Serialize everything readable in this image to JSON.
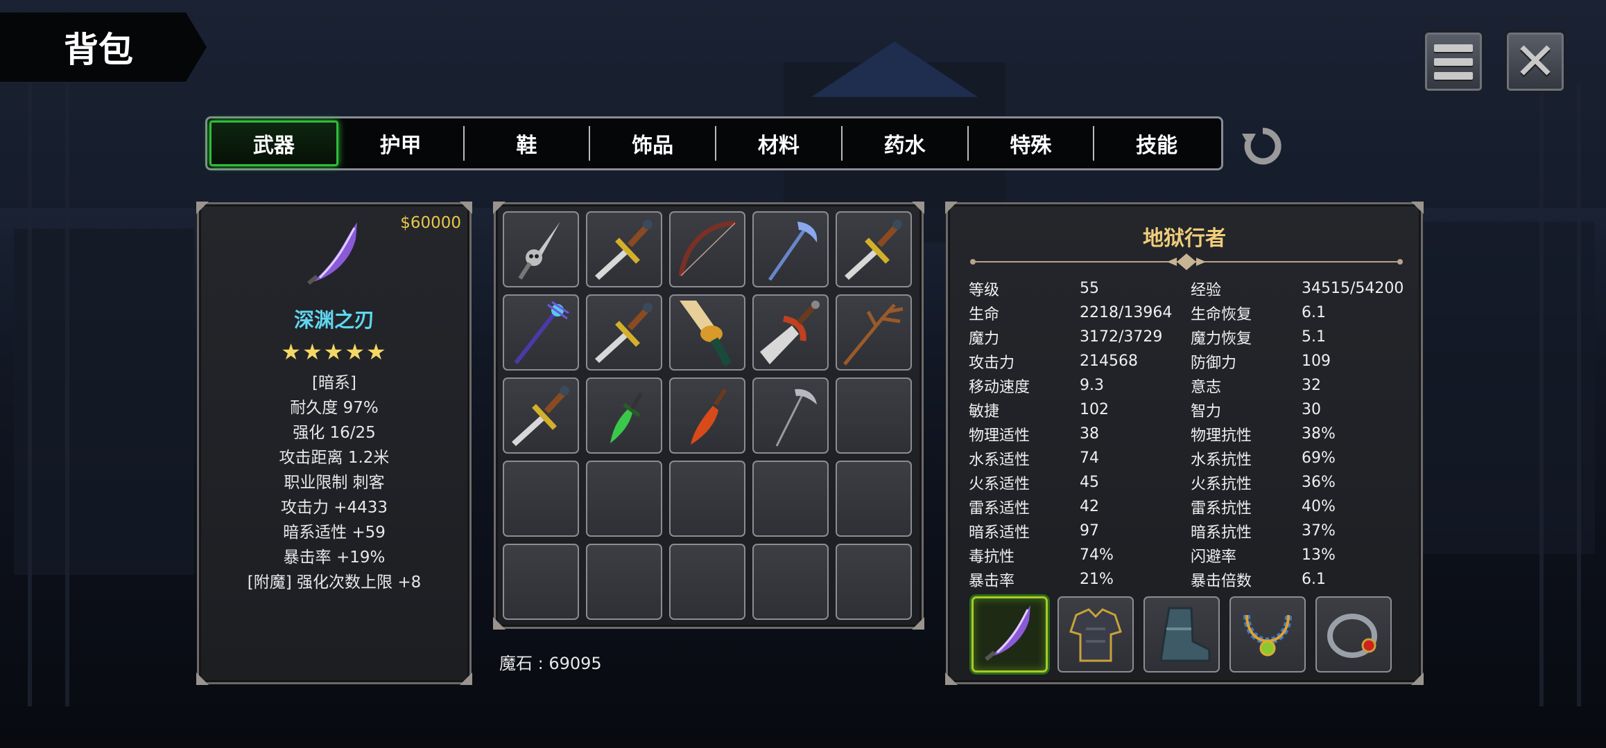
{
  "title": "背包",
  "tabs": [
    {
      "label": "武器",
      "active": true
    },
    {
      "label": "护甲",
      "active": false
    },
    {
      "label": "鞋",
      "active": false
    },
    {
      "label": "饰品",
      "active": false
    },
    {
      "label": "材料",
      "active": false
    },
    {
      "label": "药水",
      "active": false
    },
    {
      "label": "特殊",
      "active": false
    },
    {
      "label": "技能",
      "active": false
    }
  ],
  "selected_item": {
    "price": "$60000",
    "name": "深渊之刃",
    "stars": "★★★★★",
    "lines": [
      "[暗系]",
      "耐久度 97%",
      "强化 16/25",
      "攻击距离  1.2米",
      "职业限制  刺客",
      "攻击力  +4433",
      "暗系适性  +59",
      "暴击率  +19%",
      "[附魔] 强化次数上限 +8"
    ],
    "icon": "abyss-blade-icon"
  },
  "inventory_slots": [
    "skull-dagger-icon",
    "gold-sword-icon",
    "bow-icon",
    "ice-scythe-icon",
    "gold-sword-icon",
    "arcane-staff-icon",
    "gold-sword-icon",
    "katana-icon",
    "broadsword-icon",
    "branch-staff-icon",
    "gold-sword-icon",
    "green-dagger-icon",
    "fire-blade-icon",
    "scythe-icon",
    "",
    "",
    "",
    "",
    "",
    "",
    "",
    "",
    "",
    "",
    ""
  ],
  "mana_stone": "魔石 : 69095",
  "character": {
    "name": "地狱行者",
    "stats": [
      [
        "等级",
        "55",
        "经验",
        "34515/54200"
      ],
      [
        "生命",
        "2218/13964",
        "生命恢复",
        "6.1"
      ],
      [
        "魔力",
        "3172/3729",
        "魔力恢复",
        "5.1"
      ],
      [
        "攻击力",
        "214568",
        "防御力",
        "109"
      ],
      [
        "移动速度",
        "9.3",
        "意志",
        "32"
      ],
      [
        "敏捷",
        "102",
        "智力",
        "30"
      ],
      [
        "物理适性",
        "38",
        "物理抗性",
        "38%"
      ],
      [
        "水系适性",
        "74",
        "水系抗性",
        "69%"
      ],
      [
        "火系适性",
        "45",
        "火系抗性",
        "36%"
      ],
      [
        "雷系适性",
        "42",
        "雷系抗性",
        "40%"
      ],
      [
        "暗系适性",
        "97",
        "暗系抗性",
        "37%"
      ],
      [
        "毒抗性",
        "74%",
        "闪避率",
        "13%"
      ],
      [
        "暴击率",
        "21%",
        "暴击倍数",
        "6.1"
      ]
    ],
    "equipment": [
      "abyss-blade-icon",
      "chest-armor-icon",
      "boots-icon",
      "necklace-icon",
      "ring-icon"
    ]
  },
  "colors": {
    "accent_green": "#2fbc3a",
    "item_name": "#5fd6ef",
    "price": "#e8c74a",
    "character_name": "#f0cd7a"
  }
}
